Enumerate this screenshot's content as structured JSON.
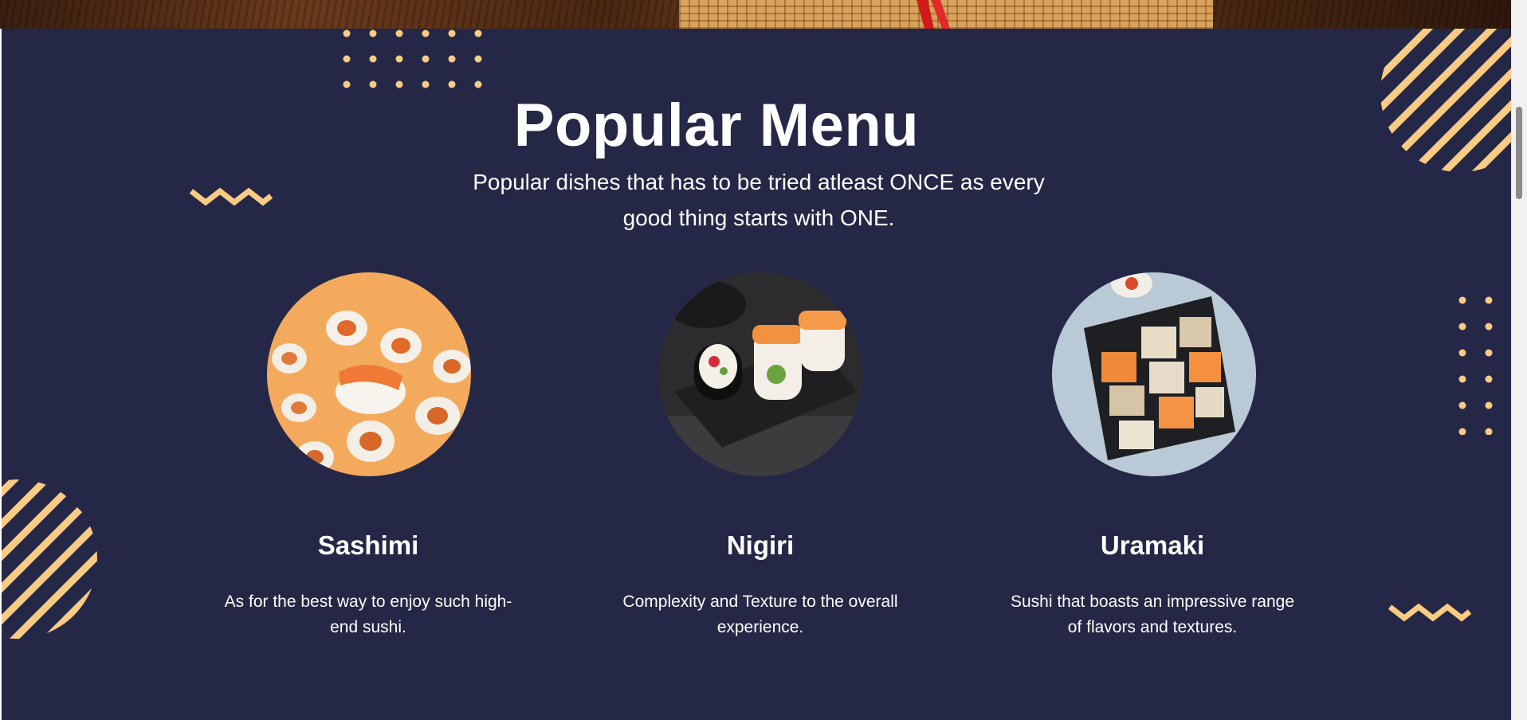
{
  "menu": {
    "title": "Popular Menu",
    "subtitle": "Popular dishes that has to be tried atleast ONCE as every good thing starts with ONE.",
    "items": [
      {
        "name": "Sashimi",
        "description": "As for the best way to enjoy such high-end sushi."
      },
      {
        "name": "Nigiri",
        "description": "Complexity and Texture to the overall experience."
      },
      {
        "name": "Uramaki",
        "description": "Sushi that boasts an impressive range of flavors and textures."
      }
    ]
  },
  "colors": {
    "background": "#252746",
    "accent": "#f9cb83",
    "text": "#ffffff"
  },
  "icons": {
    "dots": "dot-grid-icon",
    "zigzag": "zigzag-icon",
    "stripes": "striped-circle-icon"
  }
}
